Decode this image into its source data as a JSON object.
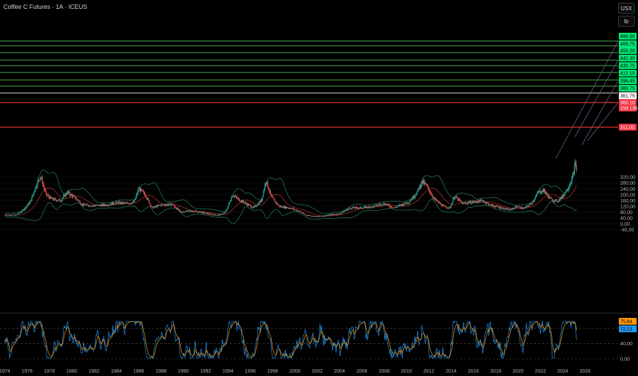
{
  "header": {
    "title": "Coffee C Futures · 1A · ICEUS",
    "currency_button": "USX",
    "unit_button": "lb"
  },
  "price_axis": {
    "ticks": [
      "320,00",
      "280,00",
      "240,00",
      "200,00",
      "160,00",
      "120,00",
      "80,00",
      "40,00",
      "0,00",
      "-40,00"
    ]
  },
  "time_axis": {
    "ticks": [
      "1974",
      "1976",
      "1978",
      "1980",
      "1982",
      "1984",
      "1986",
      "1988",
      "1990",
      "1992",
      "1994",
      "1996",
      "1998",
      "2000",
      "2002",
      "2004",
      "2006",
      "2008",
      "2010",
      "2012",
      "2014",
      "2016",
      "2018",
      "2020",
      "2022",
      "2024",
      "2026"
    ]
  },
  "level_tags": [
    {
      "text": "486,00",
      "kind": "green"
    },
    {
      "text": "469,75",
      "kind": "green"
    },
    {
      "text": "455,20",
      "kind": "green"
    },
    {
      "text": "442,30",
      "kind": "green"
    },
    {
      "text": "430,75",
      "kind": "green"
    },
    {
      "text": "412,15",
      "kind": "green"
    },
    {
      "text": "396,45",
      "kind": "green"
    },
    {
      "text": "380,75",
      "kind": "green"
    },
    {
      "text": "361,75",
      "kind": "white"
    },
    {
      "text": "360,10",
      "kind": "red"
    },
    {
      "text": "15d 13h",
      "kind": "red"
    },
    {
      "text": "311,05",
      "kind": "red"
    }
  ],
  "oscillator": {
    "axis_ticks": [
      "80,00",
      "40,00",
      "0,00"
    ],
    "tags": [
      {
        "text": "75,64",
        "kind": "orange"
      },
      {
        "text": "72,13",
        "kind": "blue"
      }
    ]
  },
  "colors": {
    "up": "#26a69a",
    "down": "#ef5350",
    "band": "#1e6b4f",
    "sma": "#c0392b",
    "level_green": "#4caf50",
    "level_red": "#e53935",
    "tag_green": "#00e676",
    "tag_red": "#f23645"
  }
}
